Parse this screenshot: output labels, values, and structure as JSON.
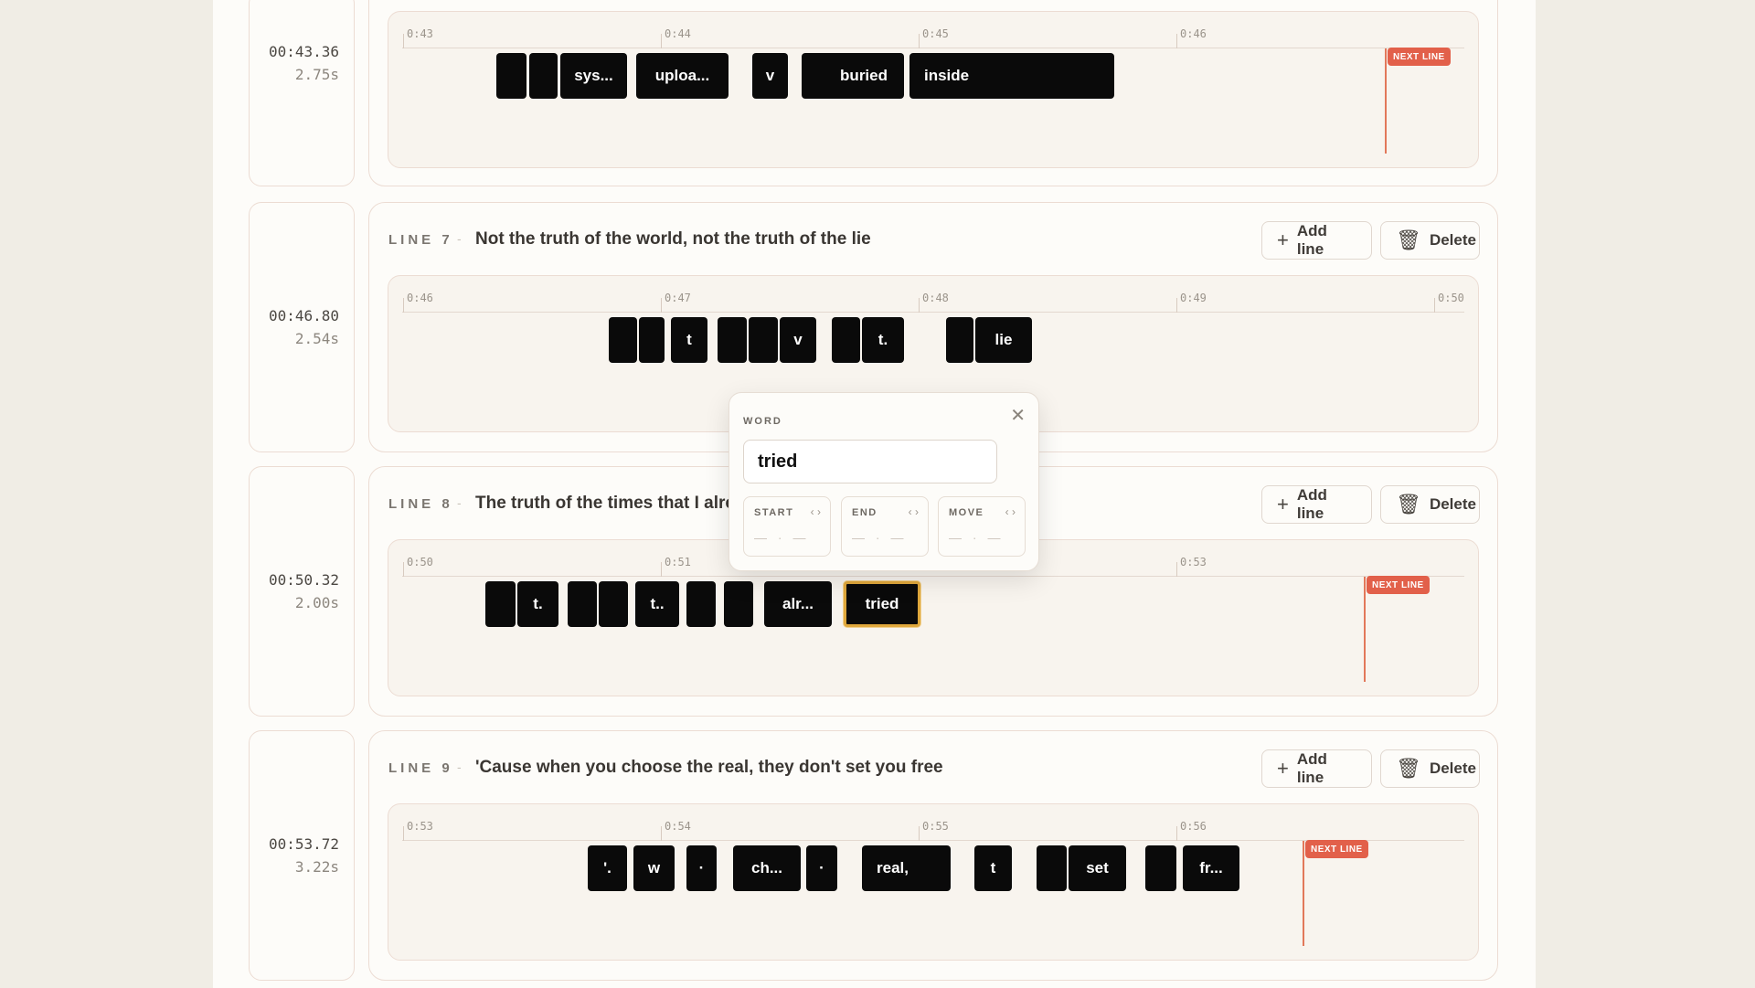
{
  "rows": [
    {
      "timestamp": "00:43.36",
      "duration": "2.75s",
      "line_label": "",
      "lyric": "",
      "ticks": [
        "0:43",
        "0:44",
        "0:45",
        "0:46"
      ],
      "words": [
        "",
        "",
        "sys...",
        "uploa...",
        "v",
        "buried",
        "inside"
      ],
      "next_line": "NEXT LINE"
    },
    {
      "timestamp": "00:46.80",
      "duration": "2.54s",
      "line_label": "LINE 7",
      "lyric": "Not the truth of the world, not the truth of the lie",
      "ticks": [
        "0:46",
        "0:47",
        "0:48",
        "0:49",
        "0:50"
      ],
      "words": [
        "",
        "",
        "t",
        "",
        "",
        "v",
        "",
        "t.",
        "",
        "lie"
      ]
    },
    {
      "timestamp": "00:50.32",
      "duration": "2.00s",
      "line_label": "LINE 8",
      "lyric": "The truth of the times that I alrea",
      "ticks": [
        "0:50",
        "0:51",
        "0:53"
      ],
      "words": [
        "",
        "t.",
        "",
        "",
        "t..",
        "",
        "",
        "alr...",
        "tried"
      ],
      "next_line": "NEXT LINE"
    },
    {
      "timestamp": "00:53.72",
      "duration": "3.22s",
      "line_label": "LINE 9",
      "lyric": "'Cause when you choose the real, they don't set you free",
      "ticks": [
        "0:53",
        "0:54",
        "0:55",
        "0:56"
      ],
      "words": [
        "'.",
        "w",
        "·",
        "ch...",
        "·",
        "real,",
        "t",
        "",
        "set",
        "",
        "fr..."
      ],
      "next_line": "NEXT LINE"
    }
  ],
  "buttons": {
    "add_line": "Add line",
    "delete": "Delete"
  },
  "separator": "-",
  "icons": {
    "plus": "plus-icon",
    "trash": "trash-icon",
    "close": "close-icon",
    "arrows": "nudge-arrows-icon"
  },
  "popup": {
    "title": "WORD",
    "close_glyph": "✕",
    "word_value": "tried",
    "start_label": "START",
    "end_label": "END",
    "move_label": "MOVE",
    "arrows": "‹ ›",
    "empty_value": "— · —"
  },
  "colors": {
    "accent": "#e2604a",
    "selection": "#e0a83c",
    "word_block": "#0a0a0a"
  }
}
